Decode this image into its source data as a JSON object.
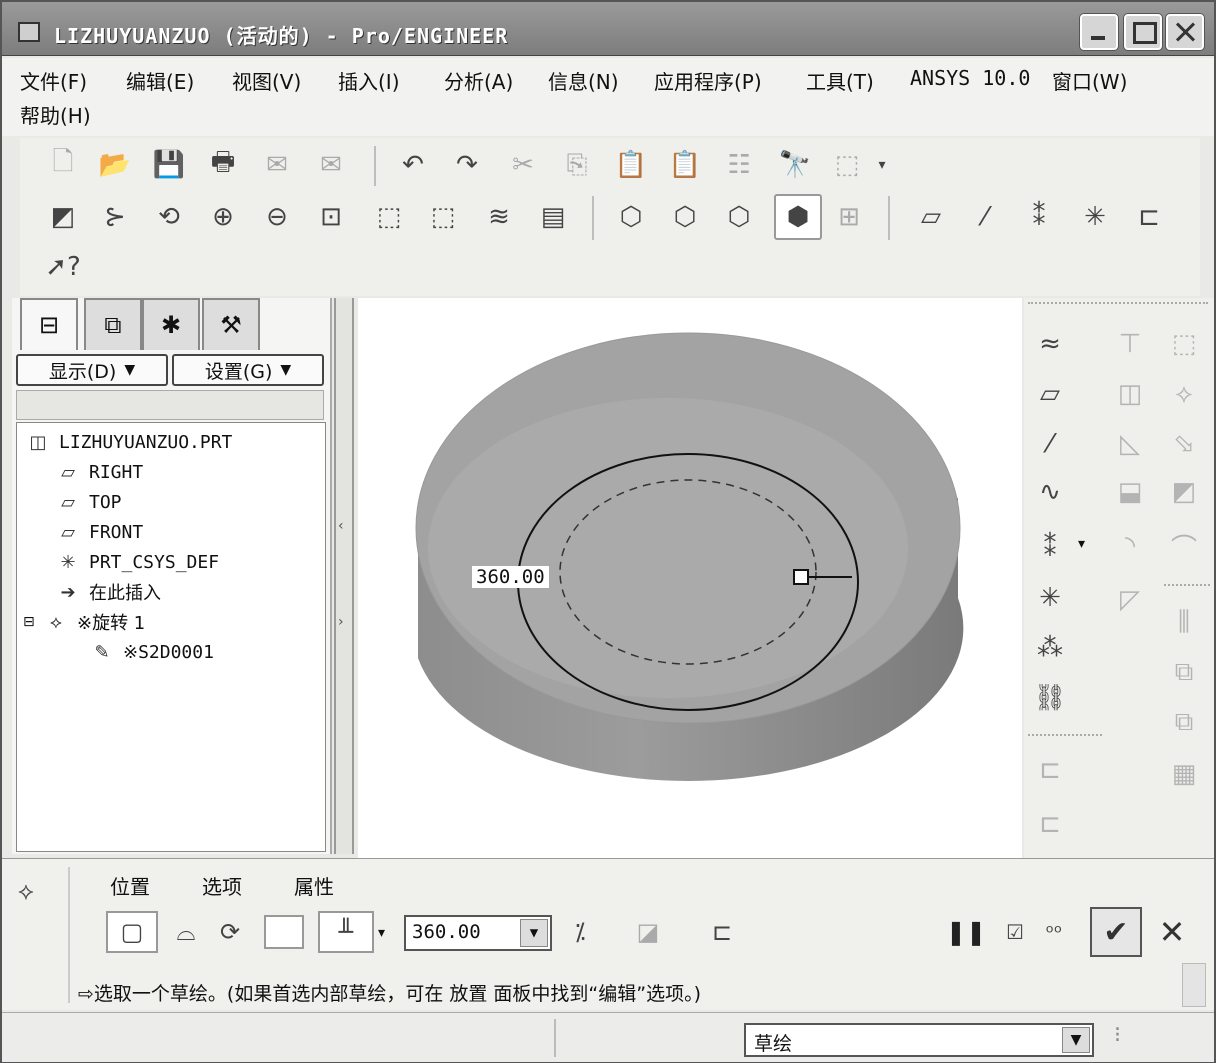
{
  "window": {
    "title": "LIZHUYUANZUO (活动的) - Pro/ENGINEER"
  },
  "menu": [
    "文件(F)",
    "编辑(E)",
    "视图(V)",
    "插入(I)",
    "分析(A)",
    "信息(N)",
    "应用程序(P)",
    "工具(T)",
    "ANSYS 10.0",
    "窗口(W)",
    "帮助(H)"
  ],
  "panel": {
    "show_button": "显示(D)",
    "settings_button": "设置(G)",
    "tree": [
      {
        "label": "LIZHUYUANZUO.PRT",
        "icon": "part-icon"
      },
      {
        "label": "RIGHT",
        "icon": "datum-plane-icon"
      },
      {
        "label": "TOP",
        "icon": "datum-plane-icon"
      },
      {
        "label": "FRONT",
        "icon": "datum-plane-icon"
      },
      {
        "label": "PRT_CSYS_DEF",
        "icon": "csys-icon"
      },
      {
        "label": "在此插入",
        "icon": "insert-arrow-icon"
      },
      {
        "label": "※旋转 1",
        "icon": "revolve-icon"
      },
      {
        "label": "※S2D0001",
        "icon": "sketch-icon"
      }
    ]
  },
  "viewport": {
    "dimension_label": "360.00"
  },
  "dashboard": {
    "tabs": [
      "位置",
      "选项",
      "属性"
    ],
    "angle_value": "360.00",
    "prompt": "⇨选取一个草绘。(如果首选内部草绘，可在 放置 面板中找到“编辑”选项。)"
  },
  "status": {
    "filter_value": "草绘"
  }
}
